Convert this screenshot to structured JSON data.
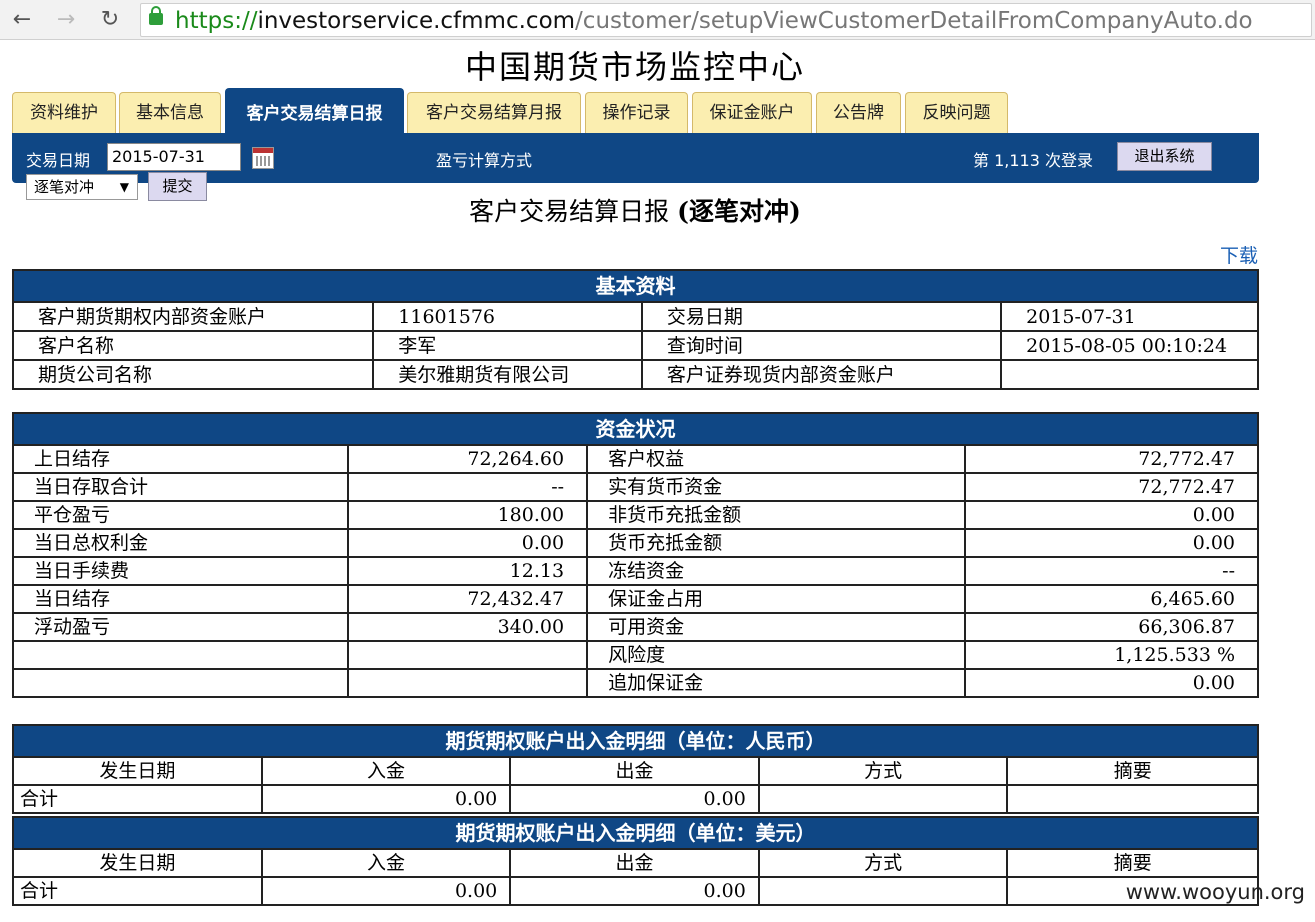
{
  "browser": {
    "back_icon": "arrow-left-icon",
    "forward_icon": "arrow-right-icon",
    "reload_icon": "reload-icon",
    "url_scheme": "https://",
    "url_host": "investorservice.cfmmc.com",
    "url_path": "/customer/setupViewCustomerDetailFromCompanyAuto.do"
  },
  "site_title": "中国期货市场监控中心",
  "tabs": [
    {
      "label": "资料维护"
    },
    {
      "label": "基本信息"
    },
    {
      "label": "客户交易结算日报",
      "active": true
    },
    {
      "label": "客户交易结算月报"
    },
    {
      "label": "操作记录"
    },
    {
      "label": "保证金账户"
    },
    {
      "label": "公告牌"
    },
    {
      "label": "反映问题"
    }
  ],
  "toolbar": {
    "date_label": "交易日期",
    "date_value": "2015-07-31",
    "calc_label": "盈亏计算方式",
    "login_count": "第 1,113 次登录",
    "logout_label": "退出系统",
    "mode_selected": "逐笔对冲",
    "submit_label": "提交"
  },
  "report": {
    "title": "客户交易结算日报",
    "mode": "(逐笔对冲)",
    "download": "下载"
  },
  "basic_info": {
    "header": "基本资料",
    "rows": [
      [
        "客户期货期权内部资金账户",
        "11601576",
        "交易日期",
        "2015-07-31"
      ],
      [
        "客户名称",
        "李军",
        "查询时间",
        "2015-08-05 00:10:24"
      ],
      [
        "期货公司名称",
        "美尔雅期货有限公司",
        "客户证券现货内部资金账户",
        ""
      ]
    ]
  },
  "funds": {
    "header": "资金状况",
    "rows": [
      [
        "上日结存",
        "72,264.60",
        "客户权益",
        "72,772.47"
      ],
      [
        "当日存取合计",
        "--",
        "实有货币资金",
        "72,772.47"
      ],
      [
        "平仓盈亏",
        "180.00",
        "非货币充抵金额",
        "0.00"
      ],
      [
        "当日总权利金",
        "0.00",
        "货币充抵金额",
        "0.00"
      ],
      [
        "当日手续费",
        "12.13",
        "冻结资金",
        "--"
      ],
      [
        "当日结存",
        "72,432.47",
        "保证金占用",
        "6,465.60"
      ],
      [
        "浮动盈亏",
        "340.00",
        "可用资金",
        "66,306.87"
      ],
      [
        "",
        "",
        "风险度",
        "1,125.533 %"
      ],
      [
        "",
        "",
        "追加保证金",
        "0.00"
      ]
    ]
  },
  "io_rmb": {
    "header": "期货期权账户出入金明细（单位：人民币）",
    "columns": [
      "发生日期",
      "入金",
      "出金",
      "方式",
      "摘要"
    ],
    "total": [
      "合计",
      "0.00",
      "0.00",
      "",
      ""
    ]
  },
  "io_usd": {
    "header": "期货期权账户出入金明细（单位：美元）",
    "columns": [
      "发生日期",
      "入金",
      "出金",
      "方式",
      "摘要"
    ],
    "total": [
      "合计",
      "0.00",
      "0.00",
      "",
      ""
    ]
  },
  "watermark": "www.wooyun.org"
}
